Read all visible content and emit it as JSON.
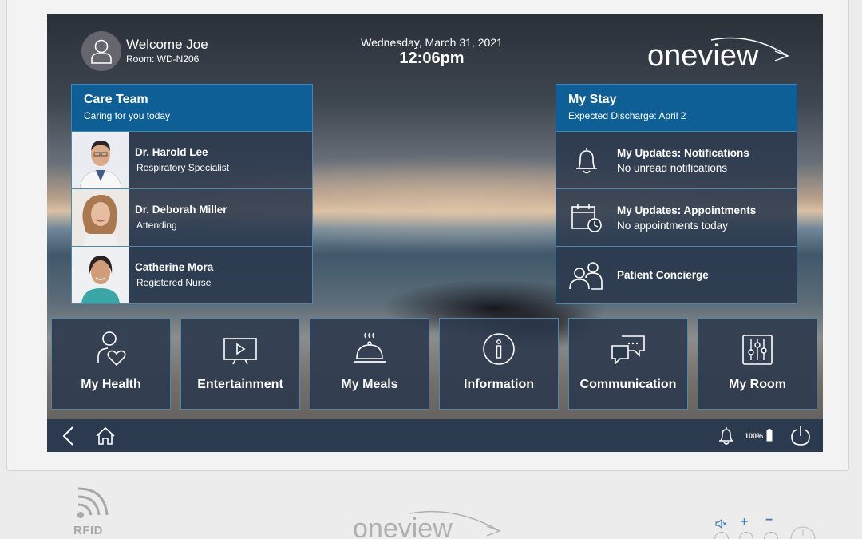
{
  "header": {
    "welcome": "Welcome Joe",
    "room": "Room: WD-N206",
    "date": "Wednesday, March 31, 2021",
    "time": "12:06pm",
    "logo_text": "oneview"
  },
  "care_team": {
    "title": "Care Team",
    "subtitle": "Caring for you today",
    "members": [
      {
        "name": "Dr. Harold Lee",
        "role": "Respiratory Specialist"
      },
      {
        "name": "Dr. Deborah Miller",
        "role": "Attending"
      },
      {
        "name": "Catherine Mora",
        "role": "Registered Nurse"
      }
    ]
  },
  "my_stay": {
    "title": "My Stay",
    "subtitle": "Expected Discharge: April 2",
    "items": [
      {
        "title": "My Updates: Notifications",
        "subtitle": "No unread notifications",
        "icon": "bell-icon"
      },
      {
        "title": "My Updates: Appointments",
        "subtitle": "No appointments today",
        "icon": "calendar-clock-icon"
      },
      {
        "title": "Patient Concierge",
        "subtitle": "",
        "icon": "people-icon"
      }
    ]
  },
  "tiles": [
    {
      "label": "My Health",
      "icon": "health-person-icon"
    },
    {
      "label": "Entertainment",
      "icon": "tv-play-icon"
    },
    {
      "label": "My Meals",
      "icon": "food-cloche-icon"
    },
    {
      "label": "Information",
      "icon": "info-icon"
    },
    {
      "label": "Communication",
      "icon": "chat-bubbles-icon"
    },
    {
      "label": "My Room",
      "icon": "sliders-icon"
    }
  ],
  "bottom_bar": {
    "battery": "100%",
    "icons": [
      "back-chevron-icon",
      "home-icon",
      "bell-icon",
      "battery-icon",
      "power-icon"
    ]
  },
  "device": {
    "rfid_label": "RFID",
    "logo_text": "oneview",
    "volume_up": "+",
    "volume_down": "−"
  },
  "colors": {
    "header_blue": "#0d5f96",
    "panel_navy": "#2a384c",
    "border_blue": "#4f88ab",
    "bar": "#2b3a4f"
  }
}
